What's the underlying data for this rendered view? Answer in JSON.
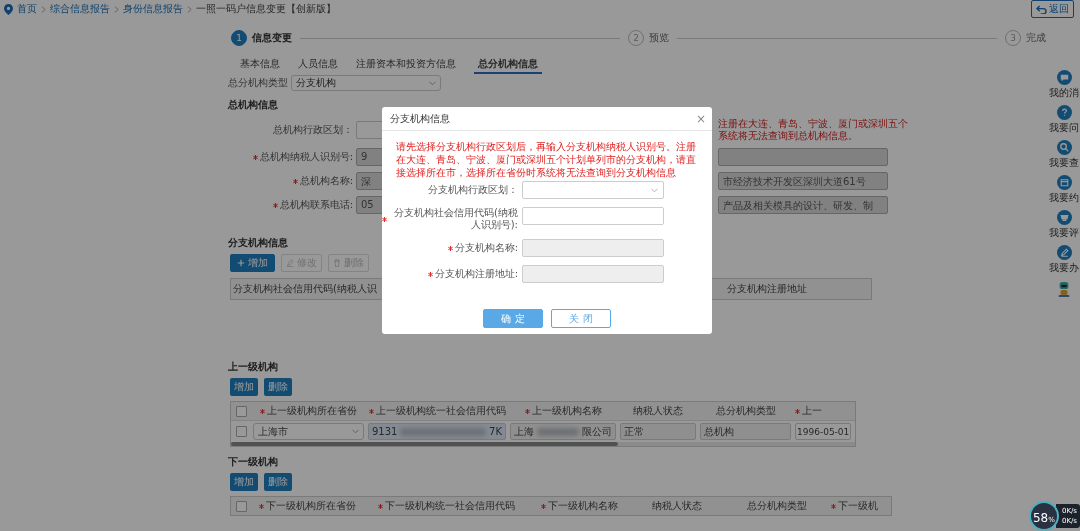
{
  "breadcrumb": [
    {
      "label": "首页",
      "link": true
    },
    {
      "label": "综合信息报告",
      "link": true
    },
    {
      "label": "身份信息报告",
      "link": true
    },
    {
      "label": "一照一码户信息变更【创新版】",
      "link": false
    }
  ],
  "back_button": {
    "label": "返回"
  },
  "steps": [
    {
      "number": "1",
      "label": "信息变更",
      "active": true
    },
    {
      "number": "2",
      "label": "预览",
      "active": false
    },
    {
      "number": "3",
      "label": "完成",
      "active": false
    }
  ],
  "tabs": [
    {
      "label": "基本信息",
      "selected": false
    },
    {
      "label": "人员信息",
      "selected": false
    },
    {
      "label": "注册资本和投资方信息",
      "selected": false
    },
    {
      "label": "总分机构信息",
      "selected": true
    }
  ],
  "org_type": {
    "label": "总分机构类型",
    "value": "分支机构"
  },
  "head_office": {
    "title": "总机构信息",
    "fields": [
      {
        "label": "总机构行政区划：",
        "required": false,
        "disabled": false
      },
      {
        "label": "总机构纳税人识别号:",
        "required": true,
        "value": "9",
        "disabled": true
      },
      {
        "label": "总机构名称:",
        "required": true,
        "value": "深",
        "disabled": true
      },
      {
        "label": "总机构联系电话:",
        "required": true,
        "value": "05",
        "disabled": true
      }
    ],
    "note_lines": [
      "注册在大连、青岛、宁波、厦门或深圳五个",
      "系统将无法查询到总机构信息。"
    ],
    "right_fields": [
      {
        "disabled": true
      },
      {
        "value": "市经济技术开发区深圳大道61号",
        "disabled": true
      },
      {
        "value": "产品及相关模具的设计、研发、制",
        "disabled": true
      }
    ]
  },
  "branch": {
    "title": "分支机构信息",
    "buttons": [
      {
        "label": "增加",
        "kind": "add",
        "disabled": false
      },
      {
        "label": "修改",
        "kind": "edit",
        "disabled": true
      },
      {
        "label": "删除",
        "kind": "delete",
        "disabled": true
      }
    ],
    "columns": [
      "分支机构社会信用代码(纳税人识",
      "分支机构注册地址"
    ]
  },
  "parent_org": {
    "title": "上一级机构",
    "buttons": [
      "增加",
      "删除"
    ],
    "header_checked": false,
    "columns": [
      {
        "label": "上一级机构所在省份",
        "required": true
      },
      {
        "label": "上一级机构统一社会信用代码",
        "required": true
      },
      {
        "label": "上一级机构名称",
        "required": true
      },
      {
        "label": "纳税人状态",
        "required": false
      },
      {
        "label": "总分机构类型",
        "required": false
      },
      {
        "label": "上一",
        "required": true
      }
    ],
    "row": {
      "checked": false,
      "province": "上海市",
      "code_start": "9131",
      "code_end": "7K",
      "name_start": "上海",
      "name_end": "限公司",
      "status": "正常",
      "org_type": "总机构",
      "date": "1996-05-01"
    }
  },
  "child_org": {
    "title": "下一级机构",
    "buttons": [
      "增加",
      "删除"
    ],
    "header_checked": false,
    "columns": [
      {
        "label": "下一级机构所在省份",
        "required": true
      },
      {
        "label": "下一级机构统一社会信用代码",
        "required": true
      },
      {
        "label": "下一级机构名称",
        "required": true
      },
      {
        "label": "纳税人状态",
        "required": false
      },
      {
        "label": "总分机构类型",
        "required": false
      },
      {
        "label": "下一级机",
        "required": true
      }
    ]
  },
  "sidebar": [
    {
      "label": "我的消",
      "kind": "message"
    },
    {
      "label": "我要问",
      "kind": "ask"
    },
    {
      "label": "我要查",
      "kind": "query"
    },
    {
      "label": "我要约",
      "kind": "book"
    },
    {
      "label": "我要评",
      "kind": "rate"
    },
    {
      "label": "我要办",
      "kind": "handle"
    },
    {
      "kind": "assistant"
    }
  ],
  "speed_widget": {
    "percent": "58",
    "unit": "%",
    "upload": "0K/s",
    "download": "0K/s"
  },
  "modal": {
    "title": "分支机构信息",
    "close": "×",
    "note": "请先选择分支机构行政区划后，再输入分支机构纳税人识别号。注册在大连、青岛、宁波、厦门或深圳五个计划单列市的分支机构，请直接选择所在市，选择所在省份时系统将无法查询到分支机构信息",
    "fields": [
      {
        "label": "分支机构行政区划：",
        "required": false,
        "kind": "select"
      },
      {
        "label": "分支机构社会信用代码(纳税人识别号):",
        "required": true,
        "kind": "input"
      },
      {
        "label": "分支机构名称:",
        "required": true,
        "kind": "disabled"
      },
      {
        "label": "分支机构注册地址:",
        "required": true,
        "kind": "disabled"
      }
    ],
    "buttons": [
      {
        "label": "确 定",
        "kind": "primary"
      },
      {
        "label": "关 闭",
        "kind": "default"
      }
    ]
  }
}
